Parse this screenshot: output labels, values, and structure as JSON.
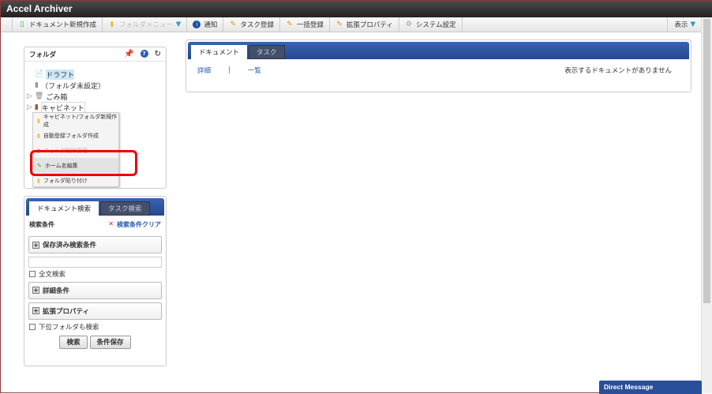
{
  "app": {
    "title": "Accel Archiver"
  },
  "toolbar": {
    "items": [
      {
        "label": "ドキュメント新規作成",
        "icon": "new-document-icon",
        "disabled": false
      },
      {
        "label": "フォルダメニュー",
        "icon": "folder-icon",
        "disabled": true
      },
      {
        "label": "通知",
        "icon": "info-icon",
        "disabled": false
      },
      {
        "label": "タスク登録",
        "icon": "pencil-add-icon",
        "disabled": false
      },
      {
        "label": "一括登録",
        "icon": "pencil-add-icon",
        "disabled": false
      },
      {
        "label": "拡張プロパティ",
        "icon": "pencil-add-icon",
        "disabled": false
      },
      {
        "label": "システム設定",
        "icon": "gear-icon",
        "disabled": false
      }
    ],
    "view_label": "表示"
  },
  "folder_panel": {
    "title": "フォルダ",
    "tree": {
      "draft": "ドラフト",
      "unset": "（フォルダ未設定）",
      "trash": "ごみ箱",
      "cabinet": "キャビネット"
    },
    "context_menu": [
      "キャビネット/フォルダ新規作成",
      "自動登録フォルダ作成",
      "フォルダ削除管理",
      "ホーム名編集",
      "フォルダ貼り付け"
    ],
    "highlighted": "ホーム名編集"
  },
  "search_panel": {
    "tabs": [
      "ドキュメント検索",
      "タスク検索"
    ],
    "criteria_label": "検索条件",
    "clear_label": "検索条件クリア",
    "saved_label": "保存済み検索条件",
    "saved_value": "",
    "fulltext_label": "全文検索",
    "detail_label": "詳細条件",
    "ext_label": "拡張プロパティ",
    "subfolder_label": "下位フォルダも検索",
    "search_btn": "検索",
    "save_btn": "条件保存"
  },
  "main": {
    "tabs": [
      "ドキュメント",
      "タスク"
    ],
    "detail_link": "詳細",
    "separator": "|",
    "list_link": "一覧",
    "empty_message": "表示するドキュメントがありません"
  },
  "direct_message": {
    "label": "Direct Message"
  },
  "colors": {
    "accent": "#2a4f9a",
    "highlight": "#e00000"
  }
}
